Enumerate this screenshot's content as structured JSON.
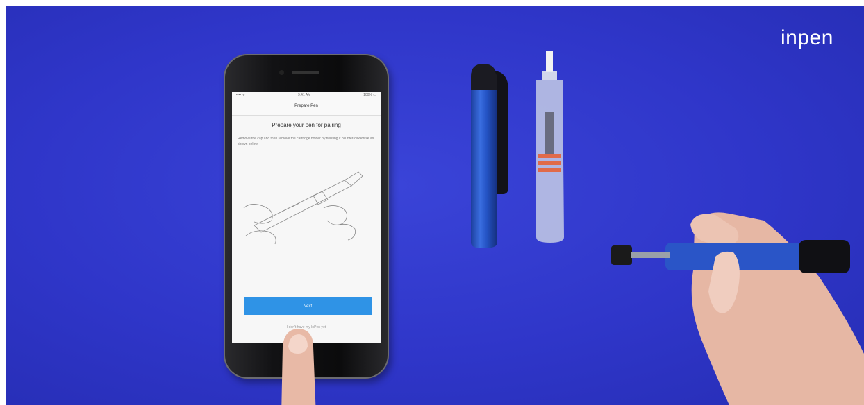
{
  "brand": {
    "logo_text": "inpen",
    "logo_color": "#ffffff"
  },
  "background_color": "#2f36c9",
  "phone_screen": {
    "status": {
      "left": "•••• ᯤ",
      "center": "9:41 AM",
      "right": "100% ▭"
    },
    "nav_title": "Prepare Pen",
    "heading": "Prepare your pen for pairing",
    "instructions": "Remove the cap and then remove the cartridge holder by twisting it counter-clockwise as shown below.",
    "next_label": "Next",
    "secondary_link": "I don't have my InPen yet",
    "accent_color": "#2f93e6"
  },
  "objects": {
    "pen_cap_label": "pen cap",
    "cartridge_label": "insulin cartridge holder",
    "pen_body_label": "InPen body held in hand"
  }
}
